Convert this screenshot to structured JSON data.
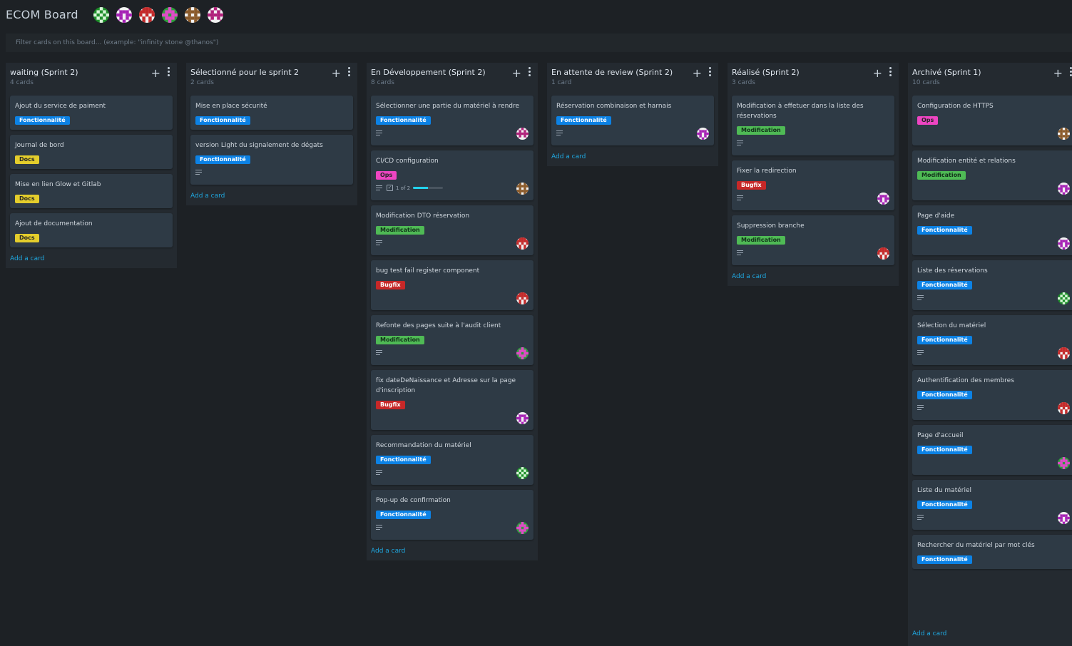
{
  "board": {
    "title": "ECOM Board",
    "members": [
      "green-avatar",
      "purple-avatar",
      "red-avatar",
      "pink-green-avatar",
      "brown-avatar",
      "magenta-avatar"
    ],
    "filter_placeholder": "Filter cards on this board... (example: \"infinity stone @thanos\")"
  },
  "add_card_label": "Add a card",
  "colors": {
    "Fonctionnalité": "#0c82e5",
    "Docs": "#e3cd2c",
    "Ops": "#ee45c2",
    "Modification": "#4fba55",
    "Bugfix": "#c62828",
    "link": "#1fa7df",
    "background": "#1d2125",
    "list": "#242a30",
    "card": "#2e3a45"
  },
  "lists": [
    {
      "title": "waiting (Sprint 2)",
      "count": "4 cards",
      "cards": [
        {
          "title": "Ajout du service de paiment",
          "label": "Fonctionnalité"
        },
        {
          "title": "Journal de bord",
          "label": "Docs"
        },
        {
          "title": "Mise en lien Glow et Gitlab",
          "label": "Docs"
        },
        {
          "title": "Ajout de documentation",
          "label": "Docs"
        }
      ]
    },
    {
      "title": "Sélectionné pour le sprint 2",
      "count": "2 cards",
      "cards": [
        {
          "title": "Mise en place sécurité",
          "label": "Fonctionnalité"
        },
        {
          "title": "version Light du signalement de dégats",
          "label": "Fonctionnalité",
          "description": true
        }
      ]
    },
    {
      "title": "En Développement (Sprint 2)",
      "count": "8 cards",
      "cards": [
        {
          "title": "Sélectionner une partie du matériel à rendre",
          "label": "Fonctionnalité",
          "description": true,
          "avatar": "magenta"
        },
        {
          "title": "CI/CD configuration",
          "label": "Ops",
          "description": true,
          "checklist": {
            "text": "1 of 2",
            "progress": 0.5
          },
          "avatar": "brown"
        },
        {
          "title": "Modification DTO réservation",
          "label": "Modification",
          "description": true,
          "avatar": "red"
        },
        {
          "title": "bug test fail register component",
          "label": "Bugfix",
          "avatar": "red"
        },
        {
          "title": "Refonte des pages suite à l'audit client",
          "label": "Modification",
          "description": true,
          "avatar": "pinkgreen"
        },
        {
          "title": "fix dateDeNaissance et Adresse sur la page d'inscription",
          "label": "Bugfix",
          "avatar": "purple"
        },
        {
          "title": "Recommandation du matériel",
          "label": "Fonctionnalité",
          "description": true,
          "avatar": "green"
        },
        {
          "title": "Pop-up de confirmation",
          "label": "Fonctionnalité",
          "description": true,
          "avatar": "pinkgreen"
        }
      ]
    },
    {
      "title": "En attente de review (Sprint 2)",
      "count": "1 card",
      "cards": [
        {
          "title": "Réservation combinaison et harnais",
          "label": "Fonctionnalité",
          "description": true,
          "avatar": "purple"
        }
      ]
    },
    {
      "title": "Réalisé (Sprint 2)",
      "count": "3 cards",
      "cards": [
        {
          "title": "Modification à effetuer dans la liste des réservations",
          "label": "Modification",
          "description": true
        },
        {
          "title": "Fixer la redirection",
          "label": "Bugfix",
          "description": true,
          "avatar": "purple"
        },
        {
          "title": "Suppression branche",
          "label": "Modification",
          "description": true,
          "avatar": "red"
        }
      ]
    },
    {
      "title": "Archivé (Sprint 1)",
      "count": "10 cards",
      "cards": [
        {
          "title": "Configuration de HTTPS",
          "label": "Ops",
          "avatar": "brown"
        },
        {
          "title": "Modification entité et relations",
          "label": "Modification",
          "avatar": "purple"
        },
        {
          "title": "Page d'aide",
          "label": "Fonctionnalité",
          "avatar": "purple"
        },
        {
          "title": "Liste des réservations",
          "label": "Fonctionnalité",
          "description": true,
          "avatar": "green"
        },
        {
          "title": "Sélection du matériel",
          "label": "Fonctionnalité",
          "description": true,
          "avatar": "red"
        },
        {
          "title": "Authentification des membres",
          "label": "Fonctionnalité",
          "description": true,
          "avatar": "red"
        },
        {
          "title": "Page d'accueil",
          "label": "Fonctionnalité",
          "avatar": "pinkgreen"
        },
        {
          "title": "Liste du matériel",
          "label": "Fonctionnalité",
          "description": true,
          "avatar": "purple"
        },
        {
          "title": "Rechercher du matériel par mot clés",
          "label": "Fonctionnalité"
        }
      ]
    }
  ]
}
